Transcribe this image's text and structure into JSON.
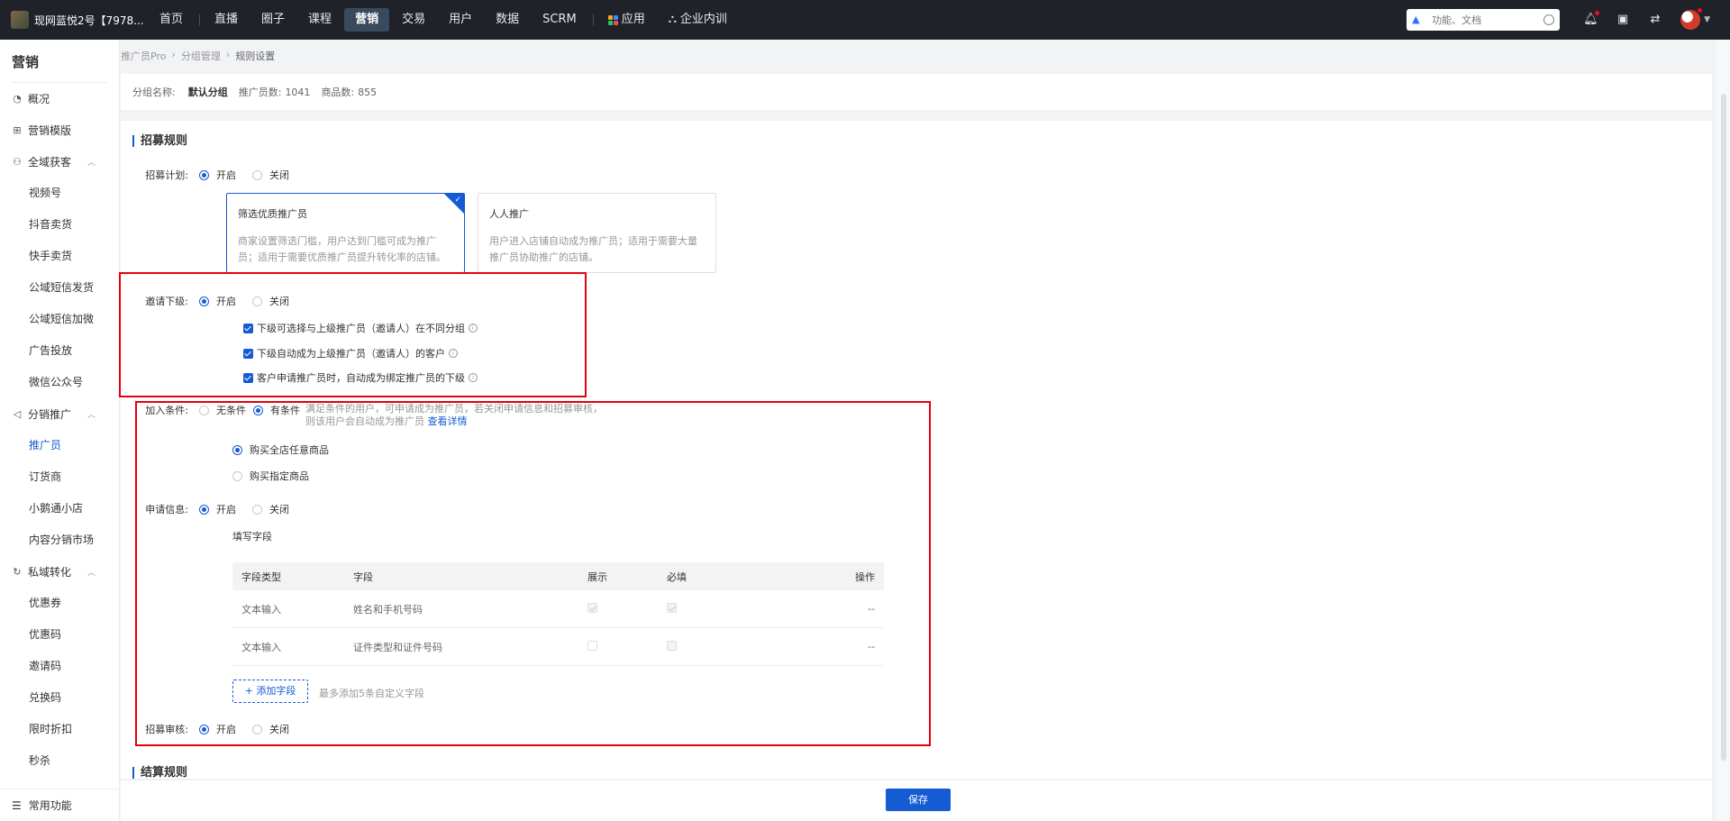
{
  "header": {
    "shop_name": "现网蓝悦2号【7978...",
    "nav": [
      {
        "label": "首页"
      },
      {
        "label": "直播"
      },
      {
        "label": "圈子"
      },
      {
        "label": "课程"
      },
      {
        "label": "营销",
        "active": true
      },
      {
        "label": "交易"
      },
      {
        "label": "用户"
      },
      {
        "label": "数据"
      },
      {
        "label": "SCRM"
      }
    ],
    "apps_label": "应用",
    "training_label": "企业内训",
    "search_placeholder": "功能、文档"
  },
  "sidebar": {
    "title": "营销",
    "items": [
      {
        "label": "概况",
        "icon": "pie-icon"
      },
      {
        "label": "营销模版",
        "icon": "grid-icon"
      },
      {
        "label": "全域获客",
        "icon": "users-icon",
        "expanded": true
      },
      {
        "label": "分销推广",
        "icon": "speaker-icon",
        "expanded": true
      },
      {
        "label": "私域转化",
        "icon": "refresh-icon",
        "expanded": true
      }
    ],
    "group1": [
      "视频号",
      "抖音卖货",
      "快手卖货",
      "公域短信发货",
      "公域短信加微",
      "广告投放",
      "微信公众号"
    ],
    "group2": [
      "推广员",
      "订货商",
      "小鹅通小店",
      "内容分销市场"
    ],
    "group3": [
      "优惠券",
      "优惠码",
      "邀请码",
      "兑换码",
      "限时折扣",
      "秒杀"
    ],
    "bottom_label": "常用功能"
  },
  "breadcrumb": [
    "推广员Pro",
    "分组管理",
    "规则设置"
  ],
  "group_info": {
    "name_label": "分组名称:",
    "name_value": "默认分组",
    "promoter_label": "推广员数:",
    "promoter_count": "1041",
    "product_label": "商品数:",
    "product_count": "855"
  },
  "recruit": {
    "section_title": "招募规则",
    "plan_label": "招募计划:",
    "on": "开启",
    "off": "关闭",
    "cards": [
      {
        "title": "筛选优质推广员",
        "desc": "商家设置筛选门槛，用户达到门槛可成为推广员；适用于需要优质推广员提升转化率的店铺。",
        "selected": true
      },
      {
        "title": "人人推广",
        "desc": "用户进入店铺自动成为推广员；适用于需要大量推广员协助推广的店铺。",
        "selected": false
      }
    ],
    "invite_label": "邀请下级:",
    "invite_options": [
      "下级可选择与上级推广员（邀请人）在不同分组",
      "下级自动成为上级推广员（邀请人）的客户",
      "客户申请推广员时，自动成为绑定推广员的下级"
    ],
    "join_label": "加入条件:",
    "join_none": "无条件",
    "join_has": "有条件",
    "join_desc_1": "满足条件的用户，可申请成为推广员，若关闭申请信息和招募审核，",
    "join_desc_2": "则该用户会自动成为推广员",
    "join_link": "查看详情",
    "buy_any": "购买全店任意商品",
    "buy_specific": "购买指定商品",
    "apply_label": "申请信息:",
    "fill_fields": "填写字段",
    "table": {
      "headers": [
        "字段类型",
        "字段",
        "展示",
        "必填",
        "操作"
      ],
      "rows": [
        {
          "type": "文本输入",
          "field": "姓名和手机号码",
          "show": true,
          "required": true,
          "op": "--"
        },
        {
          "type": "文本输入",
          "field": "证件类型和证件号码",
          "show": false,
          "required": false,
          "op": "--"
        }
      ]
    },
    "add_field": "+ 添加字段",
    "add_hint": "最多添加5条自定义字段",
    "audit_label": "招募审核:"
  },
  "settle": {
    "section_title": "结算规则"
  },
  "save_label": "保存",
  "colors": {
    "primary": "#155bd4",
    "highlight": "#e3000f",
    "topbar": "#1f2329"
  }
}
